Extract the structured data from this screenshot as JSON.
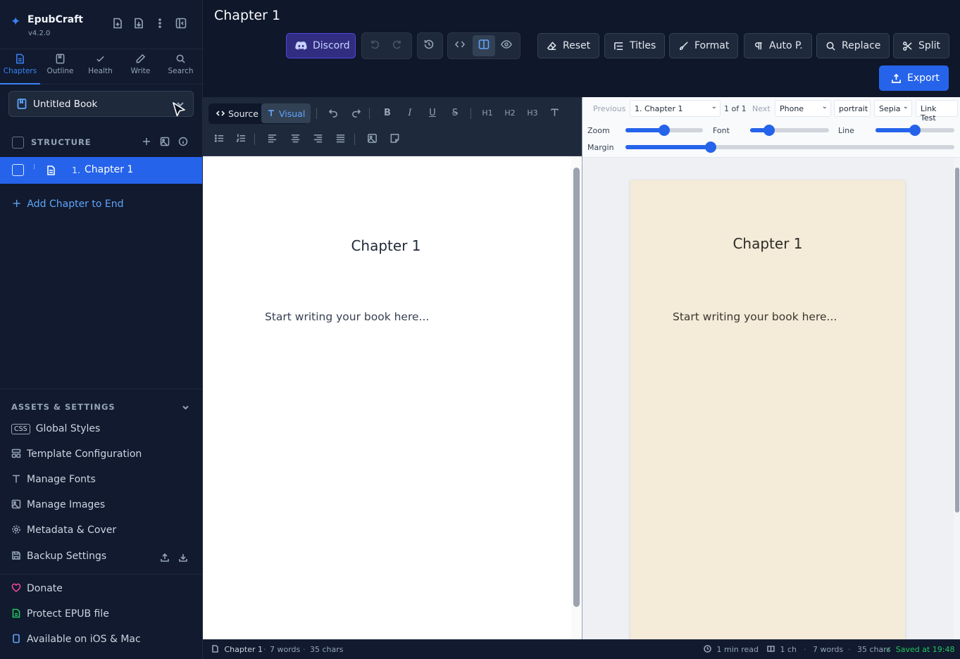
{
  "app": {
    "name": "EpubCraft",
    "version": "v4.2.0"
  },
  "nav_tabs": [
    {
      "label": "Chapters",
      "icon": "file-text-icon",
      "active": true
    },
    {
      "label": "Outline",
      "icon": "bookmark-icon"
    },
    {
      "label": "Health",
      "icon": "check-icon"
    },
    {
      "label": "Write",
      "icon": "pencil-icon"
    },
    {
      "label": "Search",
      "icon": "search-icon"
    }
  ],
  "book_selector": {
    "value": "Untitled Book"
  },
  "structure": {
    "label": "STRUCTURE"
  },
  "chapters": [
    {
      "number": "1.",
      "title": "Chapter 1",
      "selected": true
    }
  ],
  "add_chapter_label": "Add Chapter to End",
  "assets": {
    "heading": "ASSETS & SETTINGS",
    "css_badge": "CSS",
    "items": [
      "Global Styles",
      "Template Configuration",
      "Manage Fonts",
      "Manage Images",
      "Metadata & Cover",
      "Backup Settings"
    ]
  },
  "footer_links": [
    "Donate",
    "Protect EPUB file",
    "Available on iOS & Mac"
  ],
  "header": {
    "title": "Chapter 1",
    "discord": "Discord",
    "buttons": [
      "Reset",
      "Titles",
      "Format",
      "Auto P.",
      "Replace",
      "Split"
    ],
    "export": "Export"
  },
  "editor": {
    "modes": {
      "source": "Source",
      "visual": "Visual"
    },
    "heading_buttons": [
      "H1",
      "H2",
      "H3"
    ],
    "chapter_heading": "Chapter 1",
    "body_text": "Start writing your book here..."
  },
  "preview": {
    "previous": "Previous",
    "chapter_select": "1. Chapter 1",
    "page_count": "1 of 1",
    "next": "Next",
    "device": "Phone",
    "orientation": "portrait",
    "theme": "Sepia",
    "link_test": "Link Test",
    "sliders": {
      "zoom": {
        "label": "Zoom",
        "value": 0.5
      },
      "font": {
        "label": "Font",
        "value": 0.24
      },
      "line": {
        "label": "Line",
        "value": 0.5
      },
      "margin": {
        "label": "Margin",
        "value": 0.26
      }
    },
    "chapter_heading": "Chapter 1",
    "body_text": "Start writing your book here...",
    "theme_bg": "#f4ebd8"
  },
  "status": {
    "chapter": "Chapter 1",
    "words": "7 words",
    "chars": "35 chars",
    "read_time": "1 min read",
    "chapters_count": "1 ch",
    "total_words": "7 words",
    "total_chars": "35 chars",
    "saved": "Saved at 19:48"
  },
  "colors": {
    "accent": "#2563eb",
    "saved": "#22c55e",
    "discord": "#4f46e5"
  }
}
